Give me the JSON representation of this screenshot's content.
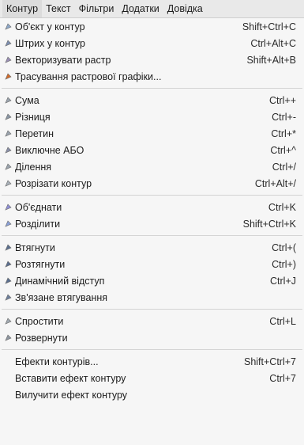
{
  "menubar": [
    "Контур",
    "Текст",
    "Фільтри",
    "Додатки",
    "Довідка"
  ],
  "menu": [
    {
      "label": "Об'єкт у контур",
      "shortcut": "Shift+Ctrl+C",
      "icon": "object-to-path-icon",
      "color": "#8da7c8"
    },
    {
      "label": "Штрих у контур",
      "shortcut": "Ctrl+Alt+C",
      "icon": "stroke-to-path-icon",
      "color": "#7d8fb0"
    },
    {
      "label": "Векторизувати растр",
      "shortcut": "Shift+Alt+B",
      "icon": "trace-bitmap-icon",
      "color": "#9a8fb5"
    },
    {
      "label": "Трасування растрової графіки...",
      "shortcut": "",
      "icon": "trace-pixel-art-icon",
      "color": "#d16a2a"
    },
    {
      "sep": true
    },
    {
      "label": "Сума",
      "shortcut": "Ctrl++",
      "icon": "union-icon",
      "color": "#9aa3ad"
    },
    {
      "label": "Різниця",
      "shortcut": "Ctrl+-",
      "icon": "difference-icon",
      "color": "#8a96a4"
    },
    {
      "label": "Перетин",
      "shortcut": "Ctrl+*",
      "icon": "intersection-icon",
      "color": "#9aa3ad"
    },
    {
      "label": "Виключне АБО",
      "shortcut": "Ctrl+^",
      "icon": "exclusion-icon",
      "color": "#8a90a8"
    },
    {
      "label": "Ділення",
      "shortcut": "Ctrl+/",
      "icon": "division-icon",
      "color": "#9aa3ad"
    },
    {
      "label": "Розрізати контур",
      "shortcut": "Ctrl+Alt+/",
      "icon": "cut-path-icon",
      "color": "#a8b0b8"
    },
    {
      "sep": true
    },
    {
      "label": "Об'єднати",
      "shortcut": "Ctrl+K",
      "icon": "combine-icon",
      "color": "#8f8fd6"
    },
    {
      "label": "Розділити",
      "shortcut": "Shift+Ctrl+K",
      "icon": "break-apart-icon",
      "color": "#8aa0d8"
    },
    {
      "sep": true
    },
    {
      "label": "Втягнути",
      "shortcut": "Ctrl+(",
      "icon": "inset-icon",
      "color": "#5b6f8f"
    },
    {
      "label": "Розтягнути",
      "shortcut": "Ctrl+)",
      "icon": "outset-icon",
      "color": "#5b6f8f"
    },
    {
      "label": "Динамічний відступ",
      "shortcut": "Ctrl+J",
      "icon": "dynamic-offset-icon",
      "color": "#5b6f8f"
    },
    {
      "label": "Зв'язане втягування",
      "shortcut": "",
      "icon": "linked-offset-icon",
      "color": "#6d7f9c"
    },
    {
      "sep": true
    },
    {
      "label": "Спростити",
      "shortcut": "Ctrl+L",
      "icon": "simplify-icon",
      "color": "#a0a8b0"
    },
    {
      "label": "Розвернути",
      "shortcut": "",
      "icon": "reverse-icon",
      "color": "#8e96a0"
    },
    {
      "sep": true
    },
    {
      "label": "Ефекти контурів...",
      "shortcut": "Shift+Ctrl+7",
      "icon": "",
      "color": ""
    },
    {
      "label": "Вставити ефект контуру",
      "shortcut": "Ctrl+7",
      "icon": "",
      "color": ""
    },
    {
      "label": "Вилучити ефект контуру",
      "shortcut": "",
      "icon": "",
      "color": ""
    }
  ]
}
